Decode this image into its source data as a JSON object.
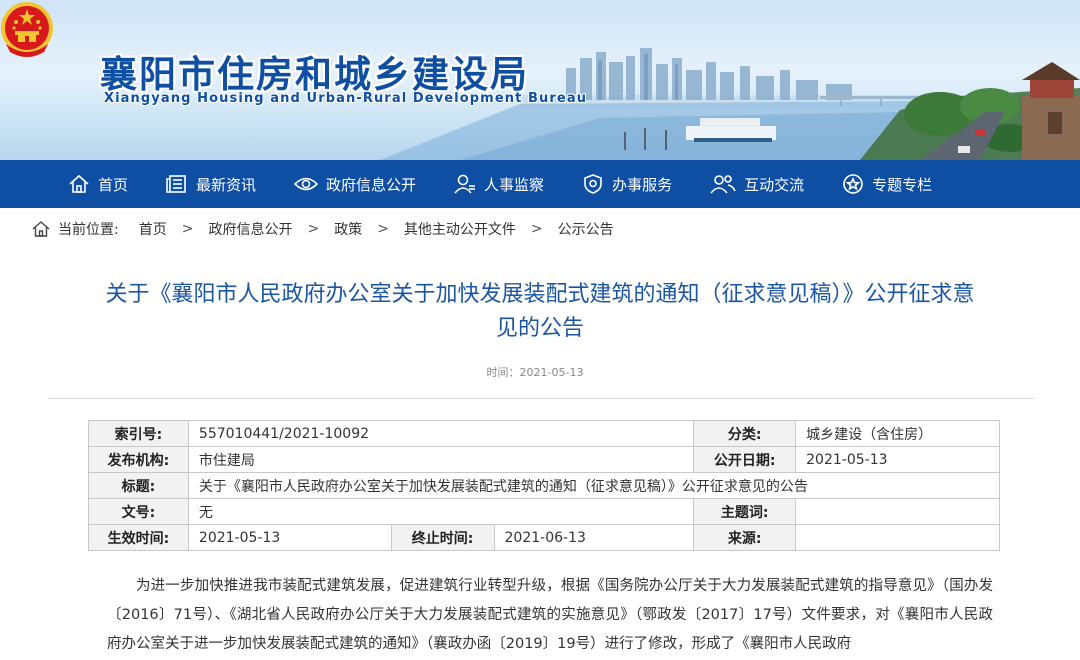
{
  "header": {
    "title": "襄阳市住房和城乡建设局",
    "subtitle": "Xiangyang Housing and Urban-Rural Development Bureau"
  },
  "nav": {
    "items": [
      {
        "label": "首页",
        "icon": "home-icon"
      },
      {
        "label": "最新资讯",
        "icon": "news-icon"
      },
      {
        "label": "政府信息公开",
        "icon": "eye-icon"
      },
      {
        "label": "人事监察",
        "icon": "person-icon"
      },
      {
        "label": "办事服务",
        "icon": "shield-icon"
      },
      {
        "label": "互动交流",
        "icon": "users-icon"
      },
      {
        "label": "专题专栏",
        "icon": "star-icon"
      }
    ]
  },
  "breadcrumb": {
    "label": "当前位置:",
    "items": [
      "首页",
      "政府信息公开",
      "政策",
      "其他主动公开文件",
      "公示公告"
    ],
    "separator": ">"
  },
  "article": {
    "title": "关于《襄阳市人民政府办公室关于加快发展装配式建筑的通知（征求意见稿）》公开征求意见的公告",
    "time": "时间：2021-05-13"
  },
  "meta": {
    "index_label": "索引号:",
    "index_value": "557010441/2021-10092",
    "category_label": "分类:",
    "category_value": "城乡建设（含住房）",
    "publisher_label": "发布机构:",
    "publisher_value": "市住建局",
    "pubdate_label": "公开日期:",
    "pubdate_value": "2021-05-13",
    "title_label": "标题:",
    "title_value": "关于《襄阳市人民政府办公室关于加快发展装配式建筑的通知（征求意见稿）》公开征求意见的公告",
    "docno_label": "文号:",
    "docno_value": "无",
    "subject_label": "主题词:",
    "subject_value": "",
    "effective_label": "生效时间:",
    "effective_value": "2021-05-13",
    "expiry_label": "终止时间:",
    "expiry_value": "2021-06-13",
    "source_label": "来源:",
    "source_value": ""
  },
  "body": {
    "paragraph": "为进一步加快推进我市装配式建筑发展，促进建筑行业转型升级，根据《国务院办公厅关于大力发展装配式建筑的指导意见》（国办发〔2016〕71号）、《湖北省人民政府办公厅关于大力发展装配式建筑的实施意见》（鄂政发〔2017〕17号）文件要求，对《襄阳市人民政府办公室关于进一步加快发展装配式建筑的通知》（襄政办函〔2019〕19号）进行了修改，形成了《襄阳市人民政府"
  },
  "colors": {
    "brand_blue": "#0e4fa3",
    "title_blue": "#1b56a5",
    "emblem_red": "#d7191c",
    "emblem_gold": "#f4c430"
  }
}
